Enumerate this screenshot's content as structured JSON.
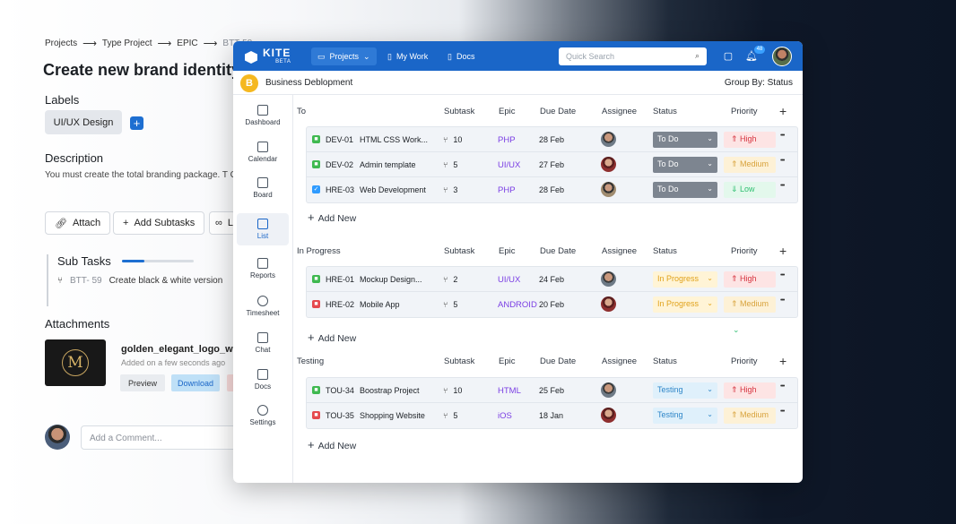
{
  "bg": {
    "breadcrumb": [
      "Projects",
      "Type Project",
      "EPIC",
      "BTT-58"
    ],
    "title": "Create new brand identity",
    "labels_heading": "Labels",
    "label_chip": "UI/UX Design",
    "add_label": "+",
    "description_heading": "Description",
    "description_text": "You must create the total branding package. T Course a great log.",
    "attach_label": "Attach",
    "add_subtasks_label": "Add Subtasks",
    "link_label": "L",
    "subtasks_heading": "Sub Tasks",
    "subtasks_progress": 0.32,
    "subtask_key": "BTT- 59",
    "subtask_name": "Create black & white version",
    "attachments_heading": "Attachments",
    "file_name": "golden_elegant_logo_with_",
    "file_added": "Added on",
    "file_time": "a few seconds ago",
    "preview_label": "Preview",
    "download_label": "Download",
    "thumb_letter": "M",
    "comment_placeholder": "Add a Comment..."
  },
  "app": {
    "logo": "KITE",
    "logo_beta": "BETA",
    "nav": [
      "Projects",
      "My Work",
      "Docs"
    ],
    "search_placeholder": "Quick Search",
    "notif_count": "48",
    "project_initial": "B",
    "project_name": "Business Deblopment",
    "group_by": "Group By: Status"
  },
  "sidebar": [
    "Dashboard",
    "Calendar",
    "Board",
    "List",
    "Reports",
    "Timesheet",
    "Chat",
    "Docs",
    "Settings"
  ],
  "columns": [
    "Subtask",
    "Epic",
    "Due Date",
    "Assignee",
    "Status",
    "Priority"
  ],
  "add_task_label": "Add New",
  "groups": [
    {
      "name": "To",
      "rows": [
        {
          "type": "story",
          "key": "DEV-01",
          "name": "HTML CSS Work...",
          "subtasks": "10",
          "epic": "PHP",
          "due": "28 Feb",
          "status": "To Do",
          "status_style": "todo",
          "priority": "High",
          "priority_style": "high"
        },
        {
          "type": "story",
          "key": "DEV-02",
          "name": "Admin template",
          "subtasks": "5",
          "epic": "UI/UX",
          "due": "27 Feb",
          "status": "To Do",
          "status_style": "todo",
          "priority": "Medium",
          "priority_style": "medium"
        },
        {
          "type": "task",
          "key": "HRE-03",
          "name": "Web Development",
          "subtasks": "3",
          "epic": "PHP",
          "due": "28 Feb",
          "status": "To Do",
          "status_style": "todo",
          "priority": "Low",
          "priority_style": "low"
        }
      ]
    },
    {
      "name": "In Progress",
      "rows": [
        {
          "type": "story",
          "key": "HRE-01",
          "name": "Mockup Design...",
          "subtasks": "2",
          "epic": "UI/UX",
          "due": "24 Feb",
          "status": "In Progress",
          "status_style": "progress",
          "priority": "High",
          "priority_style": "high"
        },
        {
          "type": "bug",
          "key": "HRE-02",
          "name": "Mobile App",
          "subtasks": "5",
          "epic": "ANDROID",
          "due": "20 Feb",
          "status": "In Progress",
          "status_style": "progress",
          "priority": "Medium",
          "priority_style": "medium"
        }
      ]
    },
    {
      "name": "Testing",
      "rows": [
        {
          "type": "story",
          "key": "TOU-34",
          "name": "Boostrap Project",
          "subtasks": "10",
          "epic": "HTML",
          "due": "25 Feb",
          "status": "Testing",
          "status_style": "testing",
          "priority": "High",
          "priority_style": "high"
        },
        {
          "type": "bug",
          "key": "TOU-35",
          "name": "Shopping Website",
          "subtasks": "5",
          "epic": "iOS",
          "due": "18 Jan",
          "status": "Testing",
          "status_style": "testing",
          "priority": "Medium",
          "priority_style": "medium"
        }
      ]
    }
  ],
  "colors": {
    "brand": "#1a66c8",
    "story": "#3fb950",
    "task": "#2f9bff",
    "bug": "#e5484d",
    "epic": "#7b3fe4"
  }
}
